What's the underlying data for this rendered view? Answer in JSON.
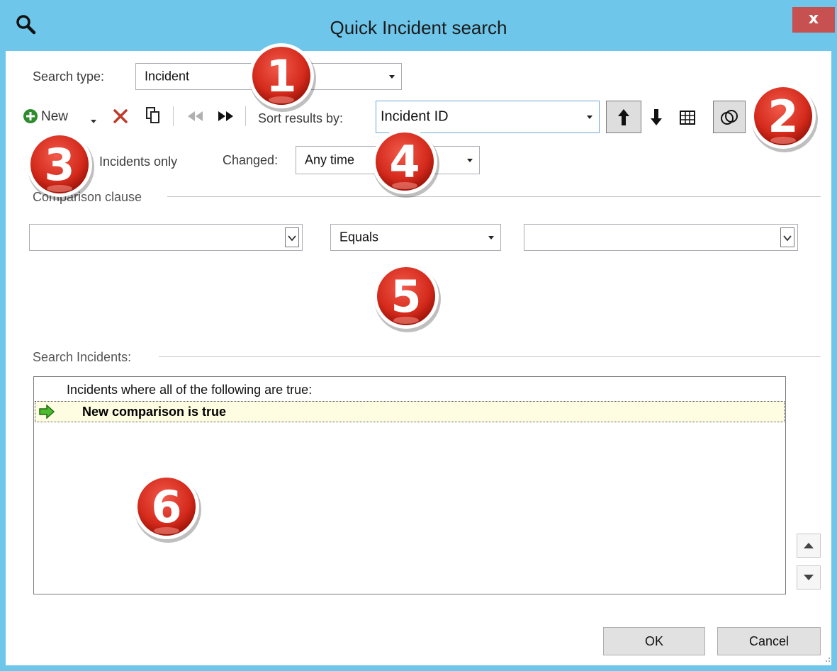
{
  "window": {
    "title": "Quick Incident search",
    "close_glyph": "x"
  },
  "search_type": {
    "label": "Search type:",
    "value": "Incident"
  },
  "toolbar": {
    "new_label": "New",
    "sort_label": "Sort results by:",
    "sort_value": "Incident ID"
  },
  "filters": {
    "incidents_only_label": "Incidents only",
    "changed_label": "Changed:",
    "changed_value": "Any time"
  },
  "comparison": {
    "group_label": "Comparison clause",
    "field_value": "",
    "operator_value": "Equals",
    "compare_value": ""
  },
  "search_incidents": {
    "group_label": "Search Incidents:",
    "header_text": "Incidents where all of the following are true:",
    "selected_item": "New comparison is true"
  },
  "footer": {
    "ok_label": "OK",
    "cancel_label": "Cancel"
  },
  "callouts": [
    "1",
    "2",
    "3",
    "4",
    "5",
    "6"
  ],
  "colors": {
    "titlebar": "#6ec6ea",
    "close": "#c75050",
    "callout_red": "#d42a1c",
    "selected_row": "#fffde1"
  }
}
